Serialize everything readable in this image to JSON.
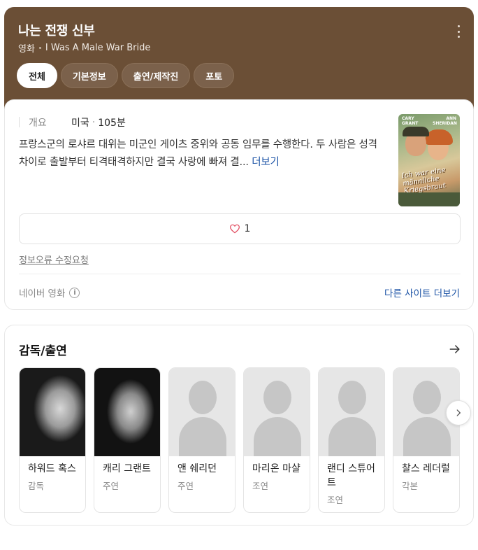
{
  "header": {
    "title": "나는 전쟁 신부",
    "genre": "영화",
    "original_title": "I Was A Male War Bride",
    "more_menu_icon": "more-vertical-icon",
    "background_color": "#6b4f36"
  },
  "tabs": [
    {
      "label": "전체",
      "active": true
    },
    {
      "label": "기본정보",
      "active": false
    },
    {
      "label": "출연/제작진",
      "active": false
    },
    {
      "label": "포토",
      "active": false
    }
  ],
  "overview": {
    "label": "개요",
    "country": "미국",
    "separator": "·",
    "runtime": "105분",
    "synopsis": "프랑스군의 로샤르 대위는 미군인 게이츠 중위와 공동 임무를 수행한다. 두 사람은 성격 차이로 출발부터 티격태격하지만 결국 사랑에 빠져 결...",
    "more_label": "더보기",
    "poster": {
      "actor1": "CARY GRANT",
      "actor2": "ANN SHERIDAN",
      "script": "Ich war eine männliche Kriegsbraut"
    },
    "like_icon": "heart-outline-icon",
    "like_count": "1",
    "report_label": "정보오류 수정요청",
    "source_label": "네이버 영화",
    "info_icon": "info-icon",
    "other_sites_label": "다른 사이트 더보기"
  },
  "cast": {
    "title": "감독/출연",
    "arrow_icon": "arrow-right-icon",
    "next_icon": "chevron-right-icon",
    "people": [
      {
        "name": "하워드 혹스",
        "role": "감독",
        "photo": "bw1"
      },
      {
        "name": "캐리 그랜트",
        "role": "주연",
        "photo": "bw2"
      },
      {
        "name": "앤 쉐리던",
        "role": "주연",
        "photo": "placeholder"
      },
      {
        "name": "마리온 마샬",
        "role": "조연",
        "photo": "placeholder"
      },
      {
        "name": "랜디 스튜어트",
        "role": "조연",
        "photo": "placeholder"
      },
      {
        "name": "찰스 레더럴",
        "role": "각본",
        "photo": "placeholder"
      }
    ]
  },
  "colors": {
    "link": "#1a52a5",
    "like_heart": "#e0455a"
  }
}
